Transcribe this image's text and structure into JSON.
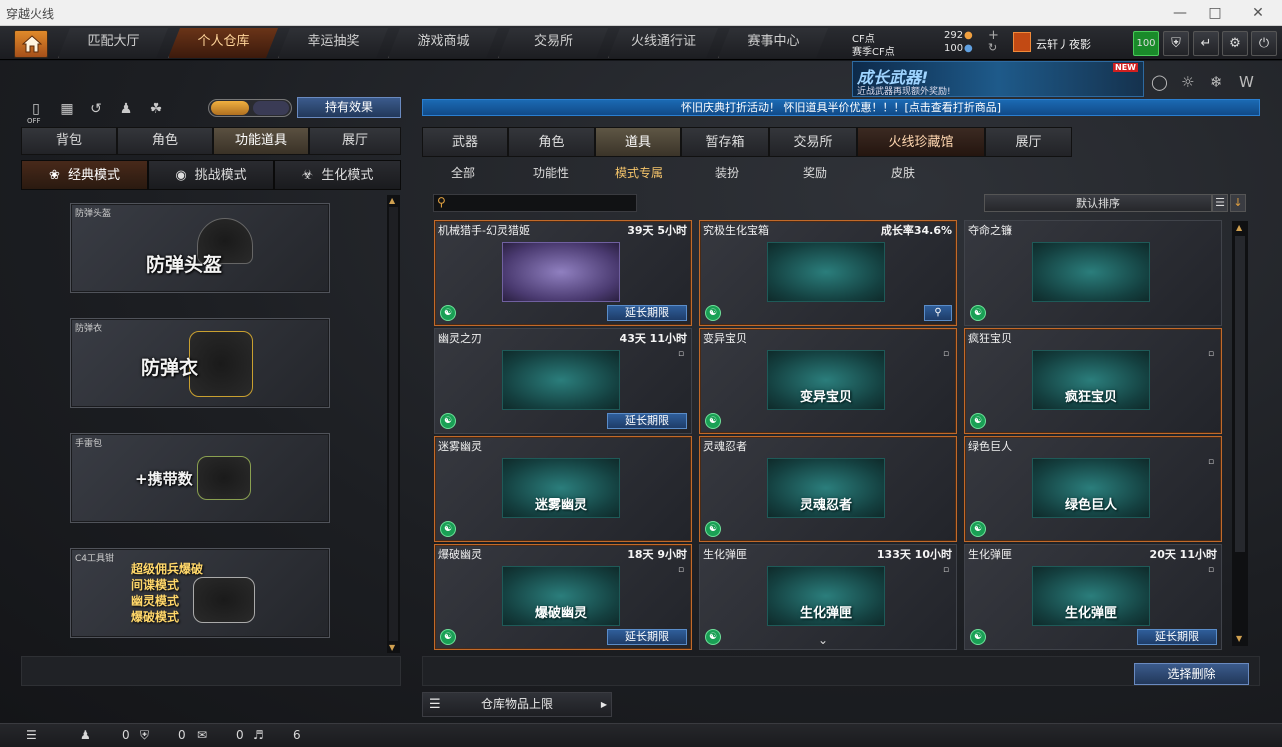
{
  "window": {
    "title": "穿越火线"
  },
  "nav": {
    "tabs": [
      "匹配大厅",
      "个人仓库",
      "幸运抽奖",
      "游戏商城",
      "交易所",
      "火线通行证",
      "赛事中心"
    ],
    "active_index": 1
  },
  "currency": {
    "cf_label": "CF点",
    "cf_value": "292",
    "match_label": "赛季CF点",
    "match_value": "100"
  },
  "user": {
    "name": "云轩丿夜影",
    "level": "100"
  },
  "promo": {
    "title": "成长武器!",
    "subtitle": "近战武器再现额外奖励!",
    "badge": "NEW"
  },
  "left": {
    "effect_button": "持有效果",
    "tabs": [
      "背包",
      "角色",
      "功能道具",
      "展厅"
    ],
    "active_tab": 2,
    "modes": [
      "经典模式",
      "挑战模式",
      "生化模式"
    ],
    "active_mode": 0,
    "cards": [
      {
        "caption": "防弹头盔",
        "title": "防弹头盔"
      },
      {
        "caption": "防弹衣",
        "title": "防弹衣"
      },
      {
        "caption": "手雷包",
        "title": "+携带数"
      },
      {
        "caption": "C4工具钳",
        "lines": [
          "超级佣兵爆破",
          "间谍模式",
          "幽灵模式",
          "爆破模式"
        ]
      }
    ],
    "toggle_off": "OFF"
  },
  "right": {
    "banner": "怀旧庆典打折活动！ 怀旧道具半价优惠！！！[点击查看打折商品]",
    "tabs": [
      "武器",
      "角色",
      "道具",
      "暂存箱",
      "交易所",
      "火线珍藏馆",
      "展厅"
    ],
    "active_tab": 2,
    "subtabs": [
      "全部",
      "功能性",
      "模式专属",
      "装扮",
      "奖励",
      "皮肤"
    ],
    "active_subtab": 2,
    "sort_label": "默认排序",
    "items": [
      {
        "name": "机械猎手-幻灵猎姬",
        "time": "39天 5小时",
        "art": "",
        "ext": "延长期限"
      },
      {
        "name": "究极生化宝箱",
        "time": "成长率34.6%",
        "art": "",
        "ext": ""
      },
      {
        "name": "夺命之镰",
        "time": "",
        "art": "",
        "ext": ""
      },
      {
        "name": "幽灵之刃",
        "time": "43天 11小时",
        "art": "",
        "ext": "延长期限"
      },
      {
        "name": "变异宝贝",
        "time": "",
        "art": "变异宝贝",
        "ext": ""
      },
      {
        "name": "疯狂宝贝",
        "time": "",
        "art": "疯狂宝贝",
        "ext": ""
      },
      {
        "name": "迷雾幽灵",
        "time": "",
        "art": "迷雾幽灵",
        "ext": ""
      },
      {
        "name": "灵魂忍者",
        "time": "",
        "art": "灵魂忍者",
        "ext": ""
      },
      {
        "name": "绿色巨人",
        "time": "",
        "art": "绿色巨人",
        "ext": ""
      },
      {
        "name": "爆破幽灵",
        "time": "18天 9小时",
        "art": "爆破幽灵",
        "ext": "延长期限"
      },
      {
        "name": "生化弹匣",
        "time": "133天 10小时",
        "art": "生化弹匣",
        "ext": ""
      },
      {
        "name": "生化弹匣",
        "time": "20天 11小时",
        "art": "生化弹匣",
        "ext": "延长期限"
      }
    ],
    "delete_button": "选择删除",
    "storage_label": "仓库物品上限"
  },
  "status": {
    "friends": "0",
    "shield": "0",
    "chat": "0",
    "volume": "6"
  }
}
